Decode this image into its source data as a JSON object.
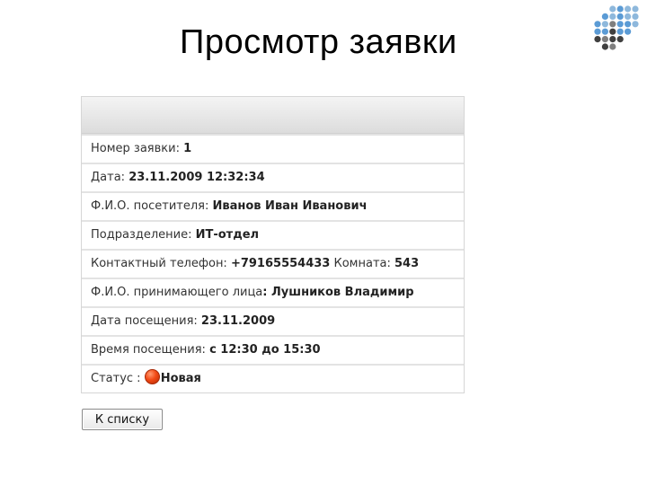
{
  "title": "Просмотр заявки",
  "rows": [
    {
      "label": "Номер заявки: ",
      "value": "1"
    },
    {
      "label": "Дата: ",
      "value": "23.11.2009 12:32:34"
    },
    {
      "label": "Ф.И.О. посетителя: ",
      "value": "Иванов Иван Иванович"
    },
    {
      "label": "Подразделение: ",
      "value": "ИТ-отдел"
    },
    {
      "label": "Контактный телефон: ",
      "value": "+79165554433",
      "label2": " Комната: ",
      "value2": "543"
    },
    {
      "label": "Ф.И.О. принимающего лица",
      "value": ": Лушников Владимир"
    },
    {
      "label": "Дата посещения: ",
      "value": "23.11.2009"
    },
    {
      "label": "Время посещения: ",
      "value": "с 12:30 до 15:30"
    },
    {
      "label": "Статус : ",
      "value": "Новая",
      "status_color": "#f24a16"
    }
  ],
  "button": {
    "label": "К списку"
  },
  "logo": {
    "icon": "dots-grid-logo",
    "colors": [
      "#5b9bd5",
      "#8eb8dc",
      "#404040",
      "#7f7f7f"
    ]
  }
}
